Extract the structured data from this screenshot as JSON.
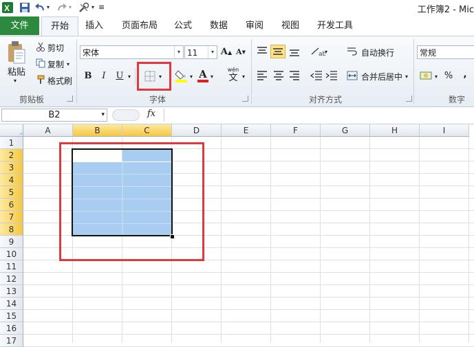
{
  "window": {
    "title": "工作簿2 - Mic"
  },
  "tabs": {
    "file": "文件",
    "items": [
      "开始",
      "插入",
      "页面布局",
      "公式",
      "数据",
      "审阅",
      "视图",
      "开发工具"
    ]
  },
  "clipboard": {
    "paste": "粘贴",
    "cut": "剪切",
    "copy": "复制",
    "format_painter": "格式刷",
    "group_label": "剪贴板"
  },
  "font": {
    "name": "宋体",
    "size": "11",
    "bold": "B",
    "italic": "I",
    "underline": "U",
    "grow": "A",
    "shrink": "A",
    "font_color_letter": "A",
    "phonetic": "wén",
    "phonetic_char": "文",
    "group_label": "字体"
  },
  "alignment": {
    "wrap_text": "自动换行",
    "merge_center": "合并后居中",
    "group_label": "对齐方式"
  },
  "number": {
    "format": "常规",
    "percent": "%",
    "comma": ",",
    "group_label": "数字"
  },
  "formula_bar": {
    "name_box": "B2",
    "fx": "fx",
    "value": ""
  },
  "sheet": {
    "columns": [
      "A",
      "B",
      "C",
      "D",
      "E",
      "F",
      "G",
      "H",
      "I"
    ],
    "selected_columns": [
      "B",
      "C"
    ],
    "rows": [
      "1",
      "2",
      "3",
      "4",
      "5",
      "6",
      "7",
      "8",
      "9",
      "10",
      "11",
      "12",
      "13",
      "14",
      "15",
      "16",
      "17"
    ],
    "selected_rows": [
      "2",
      "3",
      "4",
      "5",
      "6",
      "7",
      "8"
    ],
    "selection_range": "B2:C8",
    "active_cell": "B2"
  },
  "colors": {
    "file_tab": "#2b8a3e",
    "selection_fill": "#a9cdf0",
    "highlight_box": "#e2383b",
    "header_selected": "#f5c842"
  }
}
